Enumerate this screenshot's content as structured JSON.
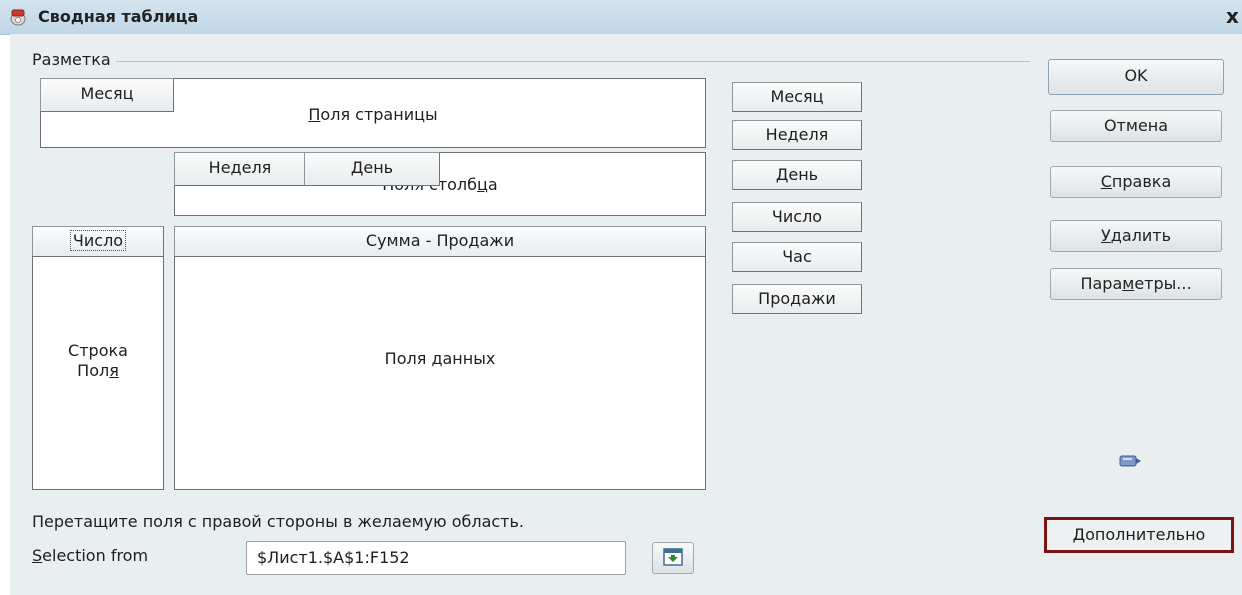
{
  "window": {
    "title": "Сводная таблица",
    "close_glyph": "x"
  },
  "layout_section": {
    "label": "Разметка"
  },
  "areas": {
    "page_fields": {
      "label_pre": "",
      "label_ul": "П",
      "label_post": "оля страницы",
      "fields": [
        "Месяц"
      ]
    },
    "column_fields": {
      "label_pre": "Поля столб",
      "label_ul": "ц",
      "label_post": "а",
      "fields": [
        "Неделя",
        "День"
      ]
    },
    "row_fields": {
      "line1": "Строка",
      "line2_pre": "Пол",
      "line2_ul": "я",
      "line2_post": "",
      "fields": [
        "Число"
      ]
    },
    "data_fields": {
      "label_pre": "Поля ",
      "label_ul": "д",
      "label_post": "анных",
      "fields": [
        "Сумма - Продажи"
      ]
    }
  },
  "available_fields": [
    "Месяц",
    "Неделя",
    "День",
    "Число",
    "Час",
    "Продажи"
  ],
  "buttons": {
    "ok": "OK",
    "cancel": "Отмена",
    "help_ul": "С",
    "help_rest": "правка",
    "delete_ul": "У",
    "delete_rest": "далить",
    "options_pre": "Пара",
    "options_ul": "м",
    "options_post": "етры...",
    "advanced": "Дополнительно"
  },
  "hint": "Перетащите поля с правой стороны в желаемую область.",
  "selection": {
    "label_ul": "S",
    "label_rest": "election from",
    "value": "$Лист1.$A$1:F152"
  },
  "icons": {
    "title": "pivot-table-icon",
    "shrink": "shrink-selection-icon",
    "drag": "drag-cursor-icon"
  },
  "colors": {
    "titlebar": "#c0d6e6",
    "dialog_bg": "#e9eef0",
    "advanced_highlight": "#7b1416"
  }
}
